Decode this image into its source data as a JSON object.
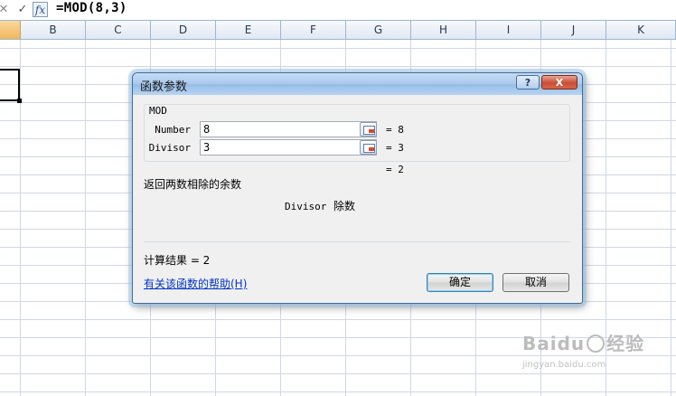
{
  "formula_bar": {
    "cancel_icon": "cross-icon",
    "enter_icon": "check-icon",
    "fx_label": "fx",
    "formula": "=MOD(8,3)"
  },
  "columns": [
    "B",
    "C",
    "D",
    "E",
    "F",
    "G",
    "H",
    "I",
    "J",
    "K"
  ],
  "dialog": {
    "title": "函数参数",
    "help_button": "?",
    "close_button": "X",
    "function_name": "MOD",
    "arguments": [
      {
        "name": "Number",
        "value": "8",
        "result": "= 8"
      },
      {
        "name": "Divisor",
        "value": "3",
        "result": "= 3"
      }
    ],
    "formula_result_inline": "= 2",
    "description": "返回两数相除的余数",
    "param_name": "Divisor",
    "param_description": "除数",
    "result_line": "计算结果 = 2",
    "help_link": "有关该函数的帮助(H)",
    "ok_label": "确定",
    "cancel_label": "取消"
  },
  "watermark": {
    "brand": "Baidu",
    "suffix": "经验",
    "url": "jingyan.baidu.com"
  },
  "colors": {
    "header_bg": "#dfe8f4",
    "grid_line": "#d0d7e5",
    "dialog_bg": "#f0f0f0",
    "link": "#0033cc"
  }
}
